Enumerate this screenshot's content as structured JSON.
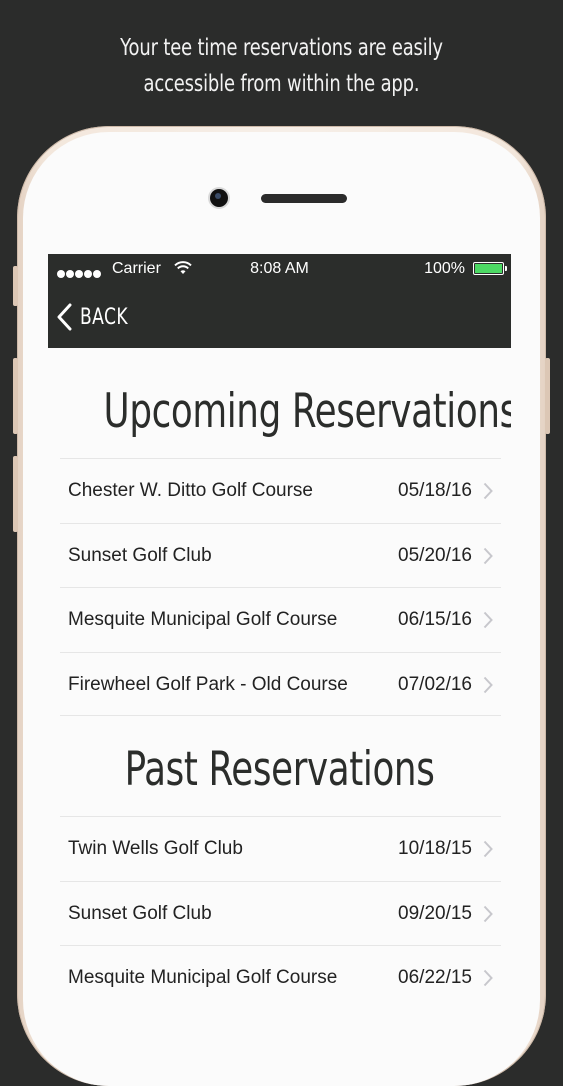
{
  "caption": {
    "line1": "Your tee time reservations are easily",
    "line2": "accessible from within the app."
  },
  "status_bar": {
    "carrier": "Carrier",
    "time": "8:08 AM",
    "battery": "100%",
    "battery_level": 1.0,
    "signal_icon": "signal-dots-icon",
    "wifi_icon": "wifi-icon"
  },
  "nav": {
    "back_label": "BACK",
    "back_icon": "chevron-left-icon"
  },
  "upcoming": {
    "title": "Upcoming Reservations",
    "items": [
      {
        "name": "Chester W. Ditto Golf Course",
        "date": "05/18/16"
      },
      {
        "name": "Sunset Golf Club",
        "date": "05/20/16"
      },
      {
        "name": "Mesquite Municipal Golf Course",
        "date": "06/15/16"
      },
      {
        "name": "Firewheel Golf Park - Old Course",
        "date": "07/02/16"
      }
    ]
  },
  "past": {
    "title": "Past Reservations",
    "items": [
      {
        "name": "Twin Wells Golf Club",
        "date": "10/18/15"
      },
      {
        "name": "Sunset Golf Club",
        "date": "09/20/15"
      },
      {
        "name": "Mesquite Municipal Golf Course",
        "date": "06/22/15"
      }
    ]
  },
  "colors": {
    "background": "#2b2c2b",
    "nav_bar": "#2b2d2b",
    "screen": "#fbfbfb",
    "battery_green": "#4cd964",
    "phone_gold": "#f3e7dc"
  }
}
